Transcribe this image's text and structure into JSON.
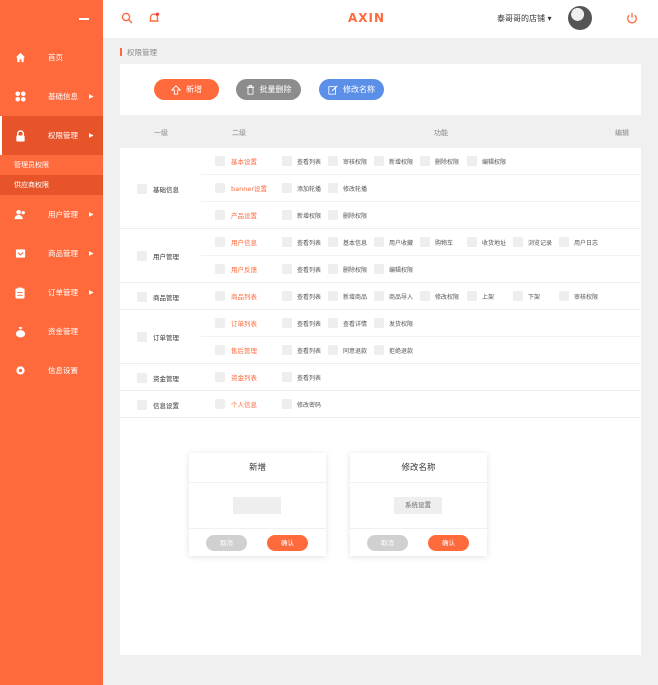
{
  "header": {
    "brand": "AXIN",
    "shop": "泰哥哥的店铺 ▾"
  },
  "sidebar": {
    "items": [
      {
        "label": "首页",
        "arrow": ""
      },
      {
        "label": "基础信息",
        "arrow": "▶"
      },
      {
        "label": "权限管理",
        "arrow": "▶"
      },
      {
        "label": "用户管理",
        "arrow": "▶"
      },
      {
        "label": "商品管理",
        "arrow": "▶"
      },
      {
        "label": "订单管理",
        "arrow": "▶"
      },
      {
        "label": "资金管理",
        "arrow": ""
      },
      {
        "label": "信息设置",
        "arrow": ""
      }
    ],
    "subitems": [
      "管理员权限",
      "供应商权限"
    ]
  },
  "breadcrumb": "权限管理",
  "toolbar": {
    "add": "新增",
    "batch_delete": "批量删除",
    "rename": "修改名称"
  },
  "columns": {
    "level1": "一级",
    "level2": "二级",
    "functions": "功能",
    "edit": "编辑"
  },
  "groups": [
    {
      "name": "基础信息",
      "rows": [
        {
          "sub": "基本设置",
          "funcs": [
            "查看列表",
            "审核权限",
            "新增权限",
            "删除权限",
            "编辑权限"
          ]
        },
        {
          "sub": "banner设置",
          "funcs": [
            "添加轮播",
            "修改轮播"
          ]
        },
        {
          "sub": "产品设置",
          "funcs": [
            "新增权限",
            "删除权限"
          ]
        }
      ]
    },
    {
      "name": "用户管理",
      "rows": [
        {
          "sub": "用户信息",
          "funcs": [
            "查看列表",
            "基本信息",
            "用户收藏",
            "购物车",
            "收货地址",
            "浏览记录",
            "用户日志"
          ]
        },
        {
          "sub": "用户反馈",
          "funcs": [
            "查看列表",
            "删除权限",
            "编辑权限"
          ]
        }
      ]
    },
    {
      "name": "商品管理",
      "rows": [
        {
          "sub": "商品列表",
          "funcs": [
            "查看列表",
            "新增商品",
            "商品导入",
            "修改权限",
            "上架",
            "下架",
            "审核权限"
          ]
        }
      ]
    },
    {
      "name": "订单管理",
      "rows": [
        {
          "sub": "订单列表",
          "funcs": [
            "查看列表",
            "查看详情",
            "发货权限"
          ]
        },
        {
          "sub": "售后管理",
          "funcs": [
            "查看列表",
            "同意退款",
            "拒绝退款"
          ]
        }
      ]
    },
    {
      "name": "资金管理",
      "rows": [
        {
          "sub": "资金列表",
          "funcs": [
            "查看列表"
          ]
        }
      ]
    },
    {
      "name": "信息设置",
      "rows": [
        {
          "sub": "个人信息",
          "funcs": [
            "修改密码"
          ]
        }
      ]
    }
  ],
  "dialog_add": {
    "title": "新增",
    "input_value": "",
    "cancel": "取消",
    "confirm": "确认"
  },
  "dialog_rename": {
    "title": "修改名称",
    "input_value": "系统设置",
    "cancel": "取消",
    "confirm": "确认"
  }
}
